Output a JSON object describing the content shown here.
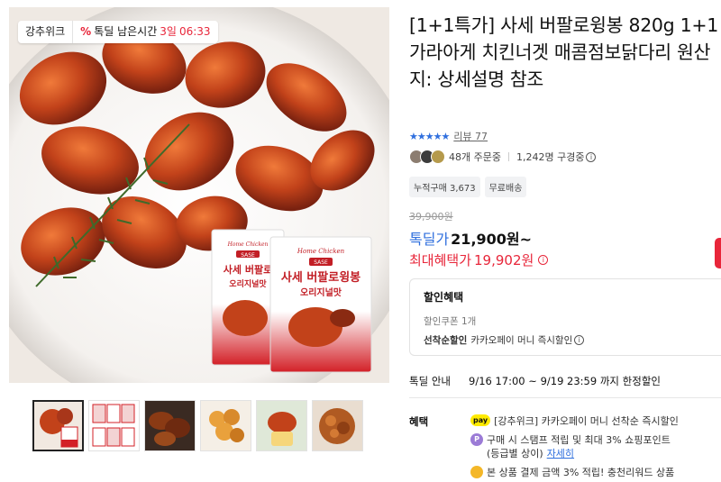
{
  "badges": {
    "seller": "강추위크",
    "deal_prefix": "톡딜 남은시간",
    "deal_days": "3일",
    "deal_time": "06:33",
    "deal_icon": "%"
  },
  "package_text": {
    "brand": "Home Chicken",
    "logo": "SASE",
    "name": "사세 버팔로윙봉",
    "flavor": "오리지널맛",
    "small_name": "사세 버팔로",
    "small_flavor": "오리지널맛"
  },
  "product": {
    "title": "[1+1특가] 사세 버팔로윙봉 820g 1+1 가라아게 치킨너겟 매콤점보닭다리 원산지: 상세설명 참조",
    "stars": "★★★★★",
    "review_label": "리뷰 77",
    "orders": "48개 주문중",
    "subscribers": "1,242명 구경중",
    "tags": [
      "누적구매 3,673",
      "무료배송"
    ],
    "original_price": "39,900원",
    "deal_label": "톡딜가",
    "deal_price": "21,900원~",
    "max_benefit_label": "최대혜택가",
    "max_benefit_price": "19,902원"
  },
  "discount_box": {
    "title": "할인혜택",
    "coupon": "할인쿠폰 1개",
    "first_bold": "선착순할인",
    "first_text": "카카오페이 머니 즉시할인"
  },
  "deal_guide": {
    "label": "톡딜 안내",
    "text": "9/16 17:00 ~ 9/19 23:59 까지 한정할인"
  },
  "benefits": {
    "label": "혜택",
    "pay_badge": "pay",
    "p_badge": "P",
    "items": [
      "[강추위크] 카카오페이 머니 선착순 즉시할인",
      "구매 시 스탬프 적립 및 최대 3% 쇼핑포인트",
      "(등급별 상이)",
      "자세히",
      "본 상품 결제 금액 3% 적립! 충천리워드 상품"
    ]
  },
  "colors": {
    "accent_red": "#e8263a",
    "accent_blue": "#2f6fde",
    "kakao_yellow": "#ffeb00"
  }
}
